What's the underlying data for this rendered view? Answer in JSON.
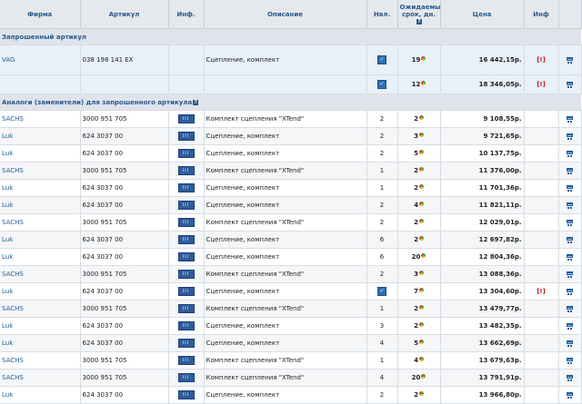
{
  "columns": {
    "brand": "Фирма",
    "article": "Артикул",
    "info": "Инф.",
    "description": "Описание",
    "stock": "Нал.",
    "delivery": "Ожидаемый срок, дн.",
    "price": "Цена",
    "info2": "Инф",
    "cart": ""
  },
  "sections": {
    "requested": "Запрошенный артикул",
    "analogs": "Аналоги (заменители) для запрошенного артикула"
  },
  "requested": {
    "brand": "VAG",
    "article": "038 198 141 EX",
    "description": "Сцепление, комплект",
    "offers": [
      {
        "days": "19",
        "price": "16 442,15р.",
        "warn": "[!]"
      },
      {
        "days": "12",
        "price": "18 346,05р.",
        "warn": "[!]"
      }
    ]
  },
  "analogs": [
    {
      "brand": "SACHS",
      "article": "3000 951 705",
      "description": "Комплект сцепления \"XTend\"",
      "stock": "2",
      "days": "2",
      "price": "9 108,55р.",
      "warn": ""
    },
    {
      "brand": "Luk",
      "article": "624 3037 00",
      "description": "Сцепление, комплект",
      "stock": "2",
      "days": "3",
      "price": "9 721,65р.",
      "warn": ""
    },
    {
      "brand": "Luk",
      "article": "624 3037 00",
      "description": "Сцепление, комплект",
      "stock": "2",
      "days": "5",
      "price": "10 137,75р.",
      "warn": ""
    },
    {
      "brand": "SACHS",
      "article": "3000 951 705",
      "description": "Комплект сцепления \"XTend\"",
      "stock": "1",
      "days": "2",
      "price": "11 376,00р.",
      "warn": ""
    },
    {
      "brand": "Luk",
      "article": "624 3037 00",
      "description": "Сцепление, комплект",
      "stock": "1",
      "days": "2",
      "price": "11 701,36р.",
      "warn": ""
    },
    {
      "brand": "Luk",
      "article": "624 3037 00",
      "description": "Сцепление, комплект",
      "stock": "2",
      "days": "4",
      "price": "11 821,11р.",
      "warn": ""
    },
    {
      "brand": "SACHS",
      "article": "3000 951 705",
      "description": "Комплект сцепления \"XTend\"",
      "stock": "2",
      "days": "2",
      "price": "12 029,01р.",
      "warn": ""
    },
    {
      "brand": "Luk",
      "article": "624 3037 00",
      "description": "Сцепление, комплект",
      "stock": "6",
      "days": "2",
      "price": "12 697,82р.",
      "warn": ""
    },
    {
      "brand": "Luk",
      "article": "624 3037 00",
      "description": "Сцепление, комплект",
      "stock": "6",
      "days": "20",
      "price": "12 804,36р.",
      "warn": ""
    },
    {
      "brand": "SACHS",
      "article": "3000 951 705",
      "description": "Комплект сцепления \"XTend\"",
      "stock": "2",
      "days": "3",
      "price": "13 088,36р.",
      "warn": ""
    },
    {
      "brand": "Luk",
      "article": "624 3037 00",
      "description": "Сцепление, комплект",
      "stock": "",
      "days": "7",
      "price": "13 304,60р.",
      "warn": "[!]"
    },
    {
      "brand": "SACHS",
      "article": "3000 951 705",
      "description": "Комплект сцепления \"XTend\"",
      "stock": "1",
      "days": "2",
      "price": "13 479,77р.",
      "warn": ""
    },
    {
      "brand": "Luk",
      "article": "624 3037 00",
      "description": "Сцепление, комплект",
      "stock": "3",
      "days": "2",
      "price": "13 482,35р.",
      "warn": ""
    },
    {
      "brand": "Luk",
      "article": "624 3037 00",
      "description": "Сцепление, комплект",
      "stock": "4",
      "days": "5",
      "price": "13 662,69р.",
      "warn": ""
    },
    {
      "brand": "SACHS",
      "article": "3000 951 705",
      "description": "Комплект сцепления \"XTend\"",
      "stock": "1",
      "days": "4",
      "price": "13 679,63р.",
      "warn": ""
    },
    {
      "brand": "SACHS",
      "article": "3000 951 705",
      "description": "Комплект сцепления \"XTend\"",
      "stock": "4",
      "days": "20",
      "price": "13 791,91р.",
      "warn": ""
    },
    {
      "brand": "Luk",
      "article": "624 3037 00",
      "description": "Сцепление, комплект",
      "stock": "2",
      "days": "2",
      "price": "13 966,80р.",
      "warn": ""
    }
  ]
}
